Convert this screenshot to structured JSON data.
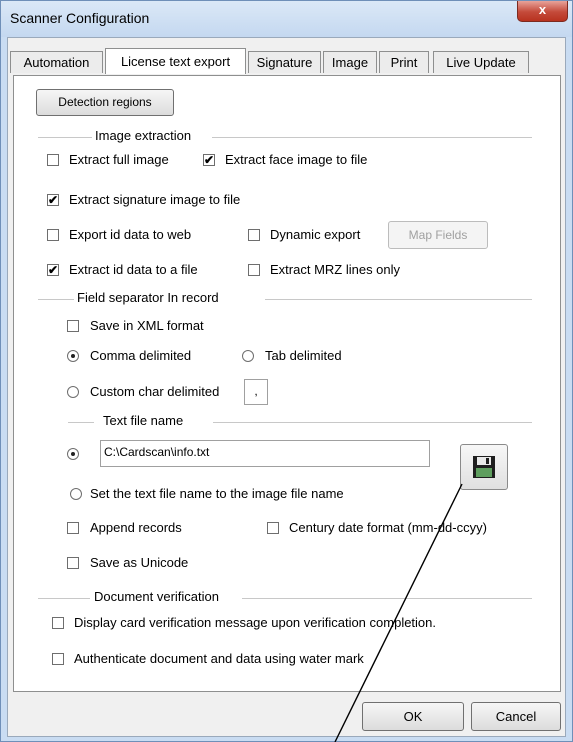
{
  "window": {
    "title": "Scanner Configuration",
    "close_glyph": "x"
  },
  "tabs": [
    {
      "label": "Automation",
      "active": false
    },
    {
      "label": "License text export",
      "active": true
    },
    {
      "label": "Signature",
      "active": false
    },
    {
      "label": "Image",
      "active": false
    },
    {
      "label": "Print",
      "active": false
    },
    {
      "label": "Live Update",
      "active": false
    }
  ],
  "detection_regions_label": "Detection regions",
  "image_extraction": {
    "title": "Image extraction",
    "extract_full_image": {
      "label": "Extract full image",
      "checked": false
    },
    "extract_face_image": {
      "label": "Extract face image to file",
      "checked": true
    },
    "extract_signature_image": {
      "label": "Extract signature image to file",
      "checked": true
    },
    "export_id_web": {
      "label": "Export id data to web",
      "checked": false
    },
    "dynamic_export": {
      "label": "Dynamic export",
      "checked": false
    },
    "map_fields_label": "Map Fields",
    "extract_id_file": {
      "label": "Extract id data to a file",
      "checked": true
    },
    "extract_mrz": {
      "label": "Extract MRZ lines only",
      "checked": false
    }
  },
  "field_separator": {
    "title": "Field separator In record",
    "save_xml": {
      "label": "Save in XML format",
      "checked": false
    },
    "comma": {
      "label": "Comma delimited",
      "selected": true
    },
    "tab": {
      "label": "Tab delimited",
      "selected": false
    },
    "custom": {
      "label": "Custom char delimited",
      "selected": false
    },
    "custom_char_value": ","
  },
  "text_file": {
    "title": "Text file name",
    "path_value": "C:\\Cardscan\\info.txt",
    "path_selected": true,
    "same_as_image": {
      "label": "Set the text file name to the image file name",
      "selected": false
    },
    "append": {
      "label": "Append records",
      "checked": false
    },
    "century_date": {
      "label": "Century date format (mm-dd-ccyy)",
      "checked": false
    },
    "unicode": {
      "label": "Save as Unicode",
      "checked": false
    },
    "save_icon": "floppy-disk-icon"
  },
  "document_verification": {
    "title": "Document verification",
    "display_msg": {
      "label": "Display card verification message upon verification completion.",
      "checked": false
    },
    "authenticate": {
      "label": "Authenticate document and data using water mark",
      "checked": false
    }
  },
  "buttons": {
    "ok": "OK",
    "cancel": "Cancel"
  },
  "colors": {
    "title_bar": "#c4d8f0",
    "close_button": "#c44a3a",
    "panel": "#ffffff"
  }
}
